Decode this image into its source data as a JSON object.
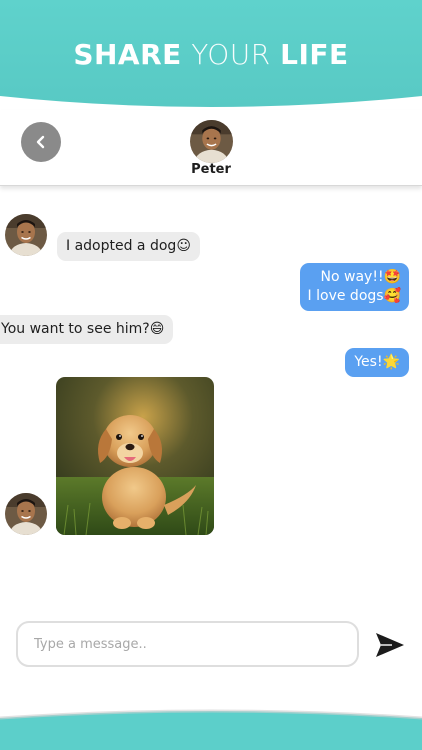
{
  "banner": {
    "headline_part1": "SHARE",
    "headline_part2": "YOUR",
    "headline_part3": "LIFE"
  },
  "header": {
    "contact_name": "Peter",
    "back_icon": "chevron-left-icon"
  },
  "messages": [
    {
      "direction": "incoming",
      "text": "I adopted a dog",
      "emoji": "☺"
    },
    {
      "direction": "outgoing",
      "line1": "No way!!",
      "emoji1": "🤩",
      "line2": "I love dogs",
      "emoji2": "🥰"
    },
    {
      "direction": "incoming",
      "text": "You want to see him?",
      "emoji": "😄"
    },
    {
      "direction": "outgoing",
      "text": "Yes!",
      "emoji": "🌟"
    },
    {
      "direction": "incoming",
      "type": "image",
      "content": "golden retriever puppy sitting in grass"
    }
  ],
  "composer": {
    "placeholder": "Type a message..",
    "send_icon": "send-icon"
  },
  "colors": {
    "teal": "#5ccfca",
    "outgoing_bubble": "#5aa0f1",
    "incoming_bubble": "#ececec",
    "back_button": "#8a8a8a"
  }
}
